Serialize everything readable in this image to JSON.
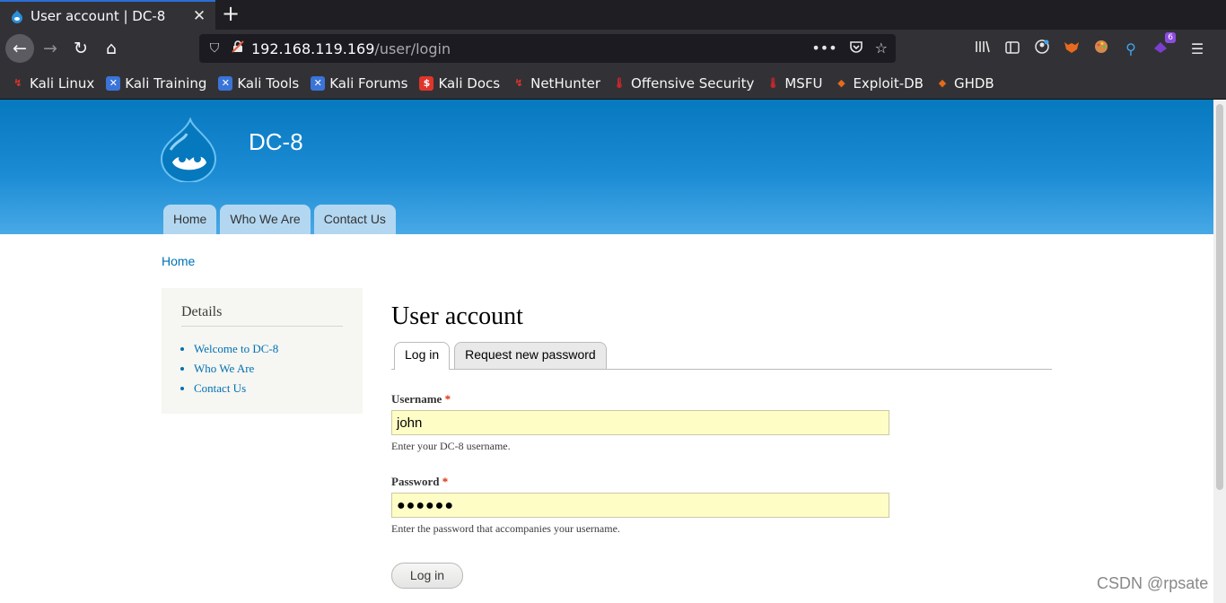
{
  "browser": {
    "tab_title": "User account | DC-8",
    "tab_close": "✕",
    "new_tab": "+",
    "url_host": "192.168.119.169",
    "url_path": "/user/login",
    "bookmarks": [
      {
        "label": "Kali Linux",
        "icon": "kali-dragon-icon",
        "color": "#e1342b"
      },
      {
        "label": "Kali Training",
        "icon": "kali-training-icon",
        "color": "#3b74d9"
      },
      {
        "label": "Kali Tools",
        "icon": "kali-tools-icon",
        "color": "#3b74d9"
      },
      {
        "label": "Kali Forums",
        "icon": "kali-forums-icon",
        "color": "#3b74d9"
      },
      {
        "label": "Kali Docs",
        "icon": "kali-docs-icon",
        "color": "#e1342b"
      },
      {
        "label": "NetHunter",
        "icon": "nethunter-icon",
        "color": "#e1342b"
      },
      {
        "label": "Offensive Security",
        "icon": "offsec-icon",
        "color": "#d4262c"
      },
      {
        "label": "MSFU",
        "icon": "msfu-icon",
        "color": "#d4262c"
      },
      {
        "label": "Exploit-DB",
        "icon": "exploit-db-icon",
        "color": "#e36b1c"
      },
      {
        "label": "GHDB",
        "icon": "ghdb-icon",
        "color": "#e36b1c"
      }
    ],
    "extension_badge": "6"
  },
  "site": {
    "name": "DC-8",
    "nav": [
      "Home",
      "Who We Are",
      "Contact Us"
    ],
    "breadcrumb": "Home"
  },
  "sidebar": {
    "title": "Details",
    "links": [
      "Welcome to DC-8",
      "Who We Are",
      "Contact Us"
    ]
  },
  "main": {
    "title": "User account",
    "tabs": [
      "Log in",
      "Request new password"
    ],
    "username": {
      "label": "Username",
      "required_mark": "*",
      "value": "john",
      "description": "Enter your DC-8 username."
    },
    "password": {
      "label": "Password",
      "required_mark": "*",
      "value": "●●●●●●",
      "description": "Enter the password that accompanies your username."
    },
    "submit_label": "Log in"
  },
  "watermark": "CSDN @rpsate",
  "colors": {
    "accent_blue": "#0779bf",
    "link": "#0071b3",
    "required": "#e32700",
    "input_bg": "#fffdc6"
  }
}
